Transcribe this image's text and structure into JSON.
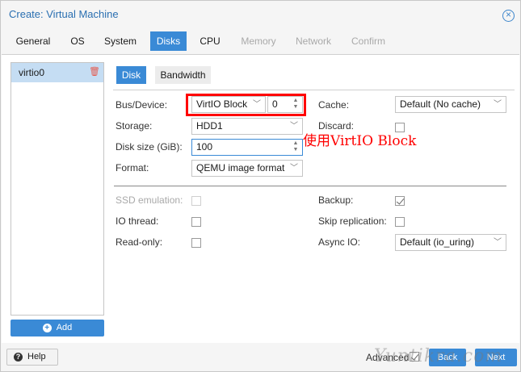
{
  "window": {
    "title": "Create: Virtual Machine"
  },
  "tabs": [
    {
      "label": "General",
      "state": "normal"
    },
    {
      "label": "OS",
      "state": "normal"
    },
    {
      "label": "System",
      "state": "normal"
    },
    {
      "label": "Disks",
      "state": "active"
    },
    {
      "label": "CPU",
      "state": "normal"
    },
    {
      "label": "Memory",
      "state": "disabled"
    },
    {
      "label": "Network",
      "state": "disabled"
    },
    {
      "label": "Confirm",
      "state": "disabled"
    }
  ],
  "disks": {
    "items": [
      {
        "label": "virtio0"
      }
    ],
    "add_label": "Add"
  },
  "subtabs": {
    "disk": "Disk",
    "bandwidth": "Bandwidth"
  },
  "form": {
    "bus_device_label": "Bus/Device:",
    "bus_value": "VirtIO Block",
    "device_index": "0",
    "storage_label": "Storage:",
    "storage_value": "HDD1",
    "disk_size_label": "Disk size (GiB):",
    "disk_size_value": "100",
    "format_label": "Format:",
    "format_value": "QEMU image format",
    "cache_label": "Cache:",
    "cache_value": "Default (No cache)",
    "discard_label": "Discard:",
    "discard_checked": false,
    "ssd_label": "SSD emulation:",
    "ssd_checked": false,
    "io_thread_label": "IO thread:",
    "io_thread_checked": false,
    "read_only_label": "Read-only:",
    "read_only_checked": false,
    "backup_label": "Backup:",
    "backup_checked": true,
    "skip_replication_label": "Skip replication:",
    "skip_replication_checked": false,
    "async_io_label": "Async IO:",
    "async_io_value": "Default (io_uring)"
  },
  "annotation": {
    "text": "使用VirtIO  Block",
    "color": "#ff0000"
  },
  "footer": {
    "help_label": "Help",
    "advanced_label": "Advanced",
    "advanced_checked": true,
    "back_label": "Back",
    "next_label": "Next"
  },
  "watermark": {
    "text": "Yuntikra.com"
  },
  "colors": {
    "accent": "#3a8ad6",
    "selected_row": "#c5ddf3",
    "annotation": "#ff0000"
  }
}
